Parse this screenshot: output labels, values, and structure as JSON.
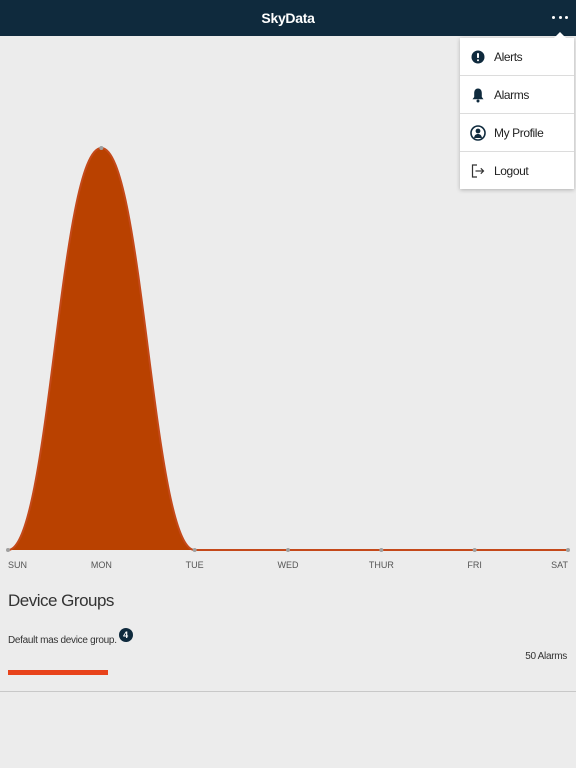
{
  "app": {
    "title": "SkyData"
  },
  "menu": {
    "items": [
      {
        "label": "Alerts",
        "icon": "exclamation-icon"
      },
      {
        "label": "Alarms",
        "icon": "bell-icon"
      },
      {
        "label": "My Profile",
        "icon": "user-icon"
      },
      {
        "label": "Logout",
        "icon": "logout-icon"
      }
    ]
  },
  "chart_data": {
    "type": "area",
    "categories": [
      "SUN",
      "MON",
      "TUE",
      "WED",
      "THUR",
      "FRI",
      "SAT"
    ],
    "values": [
      0,
      4,
      0,
      0,
      0,
      0,
      0
    ],
    "ylim": [
      0,
      4
    ],
    "grid": false,
    "colors": {
      "fill": "#b94100",
      "baseline": "#c4491a",
      "marker": "#a0a0a0"
    }
  },
  "device_groups": {
    "title": "Device Groups",
    "groups": [
      {
        "name": "Default mas device group.",
        "count": "4",
        "alarm_text": "50 Alarms",
        "bar_color": "#e8431b"
      }
    ]
  }
}
